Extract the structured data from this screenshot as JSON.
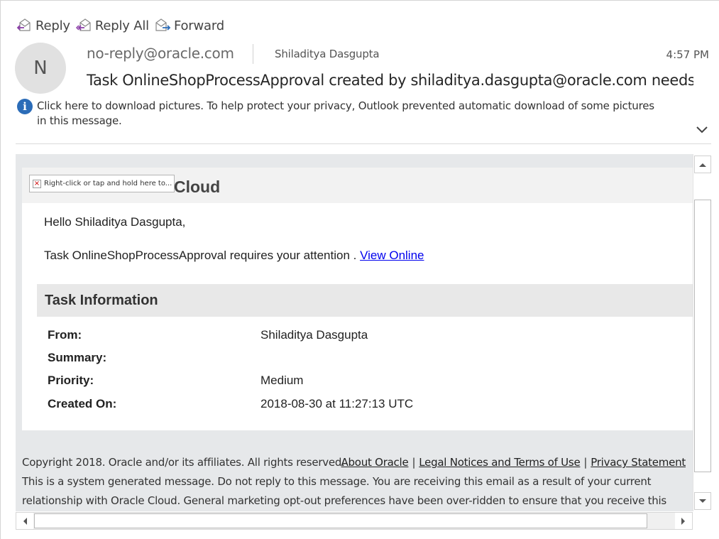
{
  "toolbar": {
    "reply": "Reply",
    "reply_all": "Reply All",
    "forward": "Forward"
  },
  "header": {
    "avatar_initial": "N",
    "sender": "no-reply@oracle.com",
    "recipient": "Shiladitya Dasgupta",
    "time": "4:57 PM",
    "subject": "Task OnlineShopProcessApproval created by shiladitya.dasgupta@oracle.com needs..."
  },
  "info_bar": {
    "icon": "info-icon",
    "text": "Click here to download pictures. To help protect your privacy, Outlook prevented automatic download of some pictures in this message."
  },
  "body": {
    "banner": {
      "broken_image_alt": "Right-click or tap and hold here to...",
      "title": "Cloud"
    },
    "greeting": "Hello Shiladitya Dasgupta,",
    "attention_text": "Task OnlineShopProcessApproval requires your attention . ",
    "view_online_link": "View Online",
    "task_info": {
      "heading": "Task Information",
      "fields": [
        {
          "label": "From:",
          "value": "Shiladitya Dasgupta"
        },
        {
          "label": "Summary:",
          "value": ""
        },
        {
          "label": "Priority:",
          "value": "Medium"
        },
        {
          "label": "Created On:",
          "value": "2018-08-30 at 11:27:13 UTC"
        }
      ]
    },
    "footer": {
      "copyright": "Copyright 2018. Oracle and/or its affiliates. All rights reserved.",
      "links": [
        "About Oracle",
        "Legal Notices and Terms of Use",
        "Privacy Statement"
      ],
      "link_separator": "|",
      "notice": "This is a system generated message. Do not reply to this message. You are receiving this email as a result of your current relationship with Oracle Cloud. General marketing opt-out preferences have been over-ridden to ensure that you receive this email."
    }
  },
  "colors": {
    "info_icon": "#2b6cb8",
    "link": "#0000ee",
    "body_background": "#e6e8ea",
    "task_header_background": "#e8e8e8"
  }
}
